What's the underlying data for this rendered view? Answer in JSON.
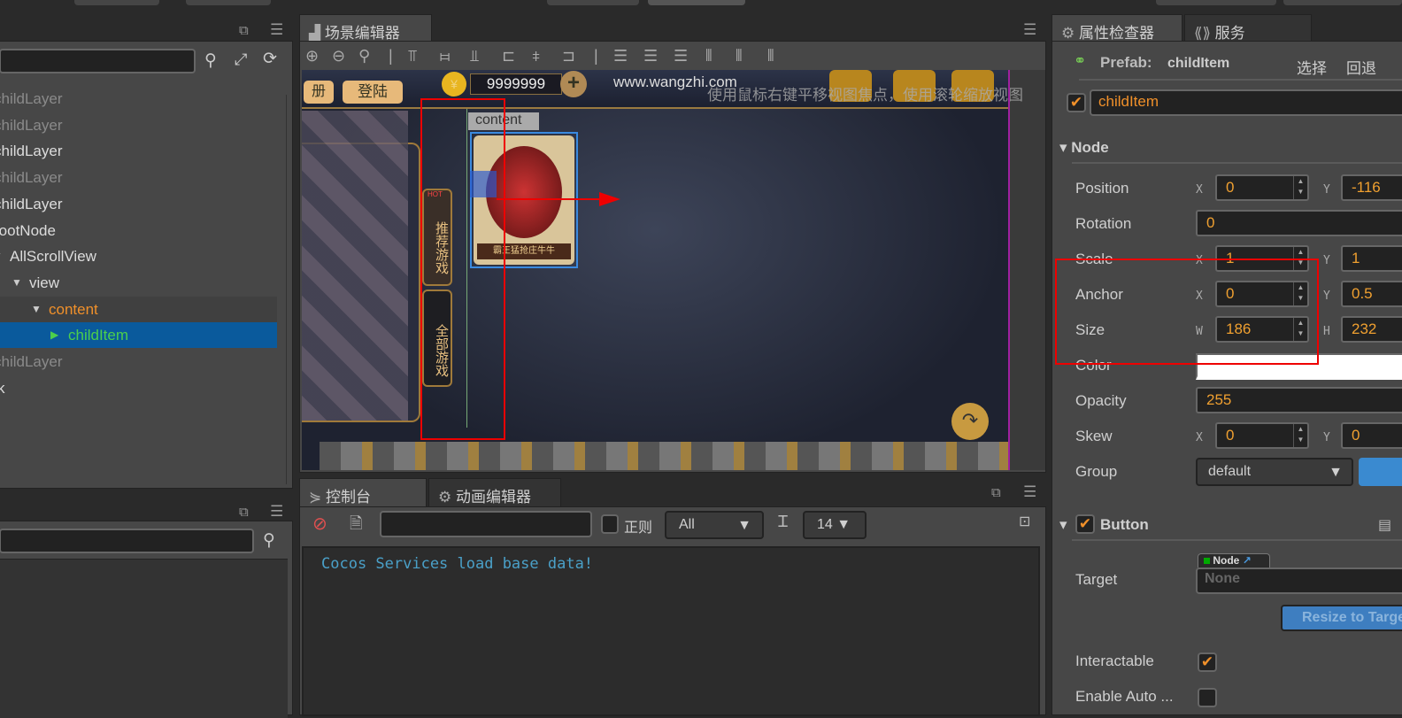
{
  "hierarchy": {
    "items": [
      {
        "label": "childLayer",
        "depth": 0,
        "dim": true
      },
      {
        "label": "childLayer",
        "depth": 0,
        "dim": true
      },
      {
        "label": "childLayer",
        "depth": 0,
        "dim": false
      },
      {
        "label": "childLayer",
        "depth": 0,
        "dim": true
      },
      {
        "label": "childLayer",
        "depth": 0,
        "dim": false
      },
      {
        "label": "rootNode",
        "depth": 0,
        "dim": false
      },
      {
        "label": "AllScrollView",
        "depth": 1,
        "dim": false
      },
      {
        "label": "view",
        "depth": 2,
        "dim": false
      },
      {
        "label": "content",
        "depth": 3,
        "dim": false
      },
      {
        "label": "childItem",
        "depth": 4,
        "dim": false,
        "selected": true
      },
      {
        "label": "childLayer",
        "depth": 0,
        "dim": true
      },
      {
        "label": "k",
        "depth": 0,
        "dim": false
      }
    ]
  },
  "scene": {
    "tab_label": "场景编辑器",
    "hint": "使用鼠标右键平移视图焦点，使用滚轮缩放视图",
    "game": {
      "btn_register": "册",
      "btn_login": "登陆",
      "coins": "9999999",
      "url": "www.wangzhi.com",
      "content_label": "content",
      "side_tab1": "推荐游戏",
      "side_tab2": "全部游戏",
      "hot": "HOT",
      "card_caption": "霸王猛抢庄牛牛"
    }
  },
  "console": {
    "tabs": [
      "控制台",
      "动画编辑器"
    ],
    "regex_label": "正则",
    "filter_value": "",
    "level_select": "All",
    "font_size_select": "14",
    "log": "Cocos Services load base data!"
  },
  "inspector": {
    "tabs": [
      "属性检查器",
      "服务"
    ],
    "prefab_label": "Prefab:",
    "prefab_name": "childItem",
    "select_btn": "选择",
    "revert_btn": "回退",
    "node_name": "childItem",
    "node_section": "Node",
    "props": {
      "position": {
        "label": "Position",
        "x": "0",
        "y": "-116"
      },
      "rotation": {
        "label": "Rotation",
        "value": "0"
      },
      "scale": {
        "label": "Scale",
        "x": "1",
        "y": "1"
      },
      "anchor": {
        "label": "Anchor",
        "x": "0",
        "y": "0.5"
      },
      "size": {
        "label": "Size",
        "w": "186",
        "h": "232"
      },
      "color": {
        "label": "Color",
        "value": "#ffffff"
      },
      "opacity": {
        "label": "Opacity",
        "value": "255"
      },
      "skew": {
        "label": "Skew",
        "x": "0",
        "y": "0"
      },
      "group": {
        "label": "Group",
        "value": "default"
      }
    },
    "button_section": "Button",
    "target_label": "Target",
    "target_type": "Node",
    "target_value": "None",
    "resize_btn": "Resize to Target",
    "interactable_label": "Interactable",
    "enable_auto_label": "Enable Auto ..."
  },
  "colors": {
    "accent": "#f0902a",
    "selected": "#0a5a9c",
    "childitem_text": "#4ccf4c",
    "annotation": "#ee0000"
  }
}
